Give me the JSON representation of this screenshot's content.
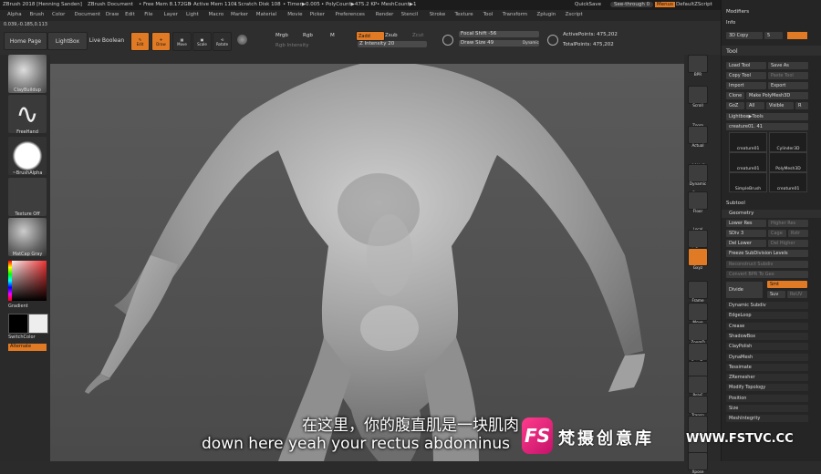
{
  "titlebar": {
    "app_title": "ZBrush 2018 [Henning Sanden]",
    "document": "ZBrush Document",
    "free_mem": "• Free Mem 8.172GB",
    "active_mem": "• Active Mem 1101",
    "scratch_disk": "• Scratch Disk 108",
    "timer": "• Timer▶0.005",
    "polycount": "• PolyCount▶475.2 KP",
    "meshcount": "• MeshCount▶1",
    "quicksave": "QuickSave",
    "see_through": "See-through  0",
    "menus": "Menus",
    "default_zscript": "DefaultZScript"
  },
  "menubar": [
    "Alpha",
    "Brush",
    "Color",
    "Document",
    "Draw",
    "Edit",
    "File",
    "Layer",
    "Light",
    "Macro",
    "Marker",
    "Material",
    "Movie",
    "Picker",
    "Preferences",
    "Render",
    "Stencil",
    "Stroke",
    "Texture",
    "Tool",
    "Transform",
    "Zplugin",
    "Zscript"
  ],
  "toolbar": {
    "coords": "0.039,-0.185,0.113",
    "home_page": "Home Page",
    "lightbox": "LightBox",
    "live_boolean": "Live Boolean",
    "edit": "Edit",
    "draw": "Draw",
    "move": "Move",
    "scale": "Scale",
    "rotate": "Rotate",
    "mrgb": "Mrgb",
    "rgb": "Rgb",
    "m": "M",
    "rgb_intensity": "Rgb Intensity",
    "zadd": "Zadd",
    "zsub": "Zsub",
    "zcut": "Zcut",
    "z_intensity": "Z Intensity 20",
    "focal_shift": "Focal Shift -56",
    "draw_size": "Draw Size 49",
    "dynamic": "Dynamic",
    "active_points": "ActivePoints: 475,202",
    "total_points": "TotalPoints: 475,202"
  },
  "leftshelf": {
    "brush": "ClayBuildup",
    "stroke": "FreeHand",
    "alpha": "~BrushAlpha",
    "texture": "Texture Off",
    "material": "MatCap Gray",
    "gradient": "Gradient",
    "switch_color": "SwitchColor",
    "alternate": "Alternate"
  },
  "rightshelf": [
    "BPR",
    "SPix 3",
    "Scroll",
    "Zoom",
    "Actual",
    "AAHalf",
    "Dynamic",
    "Persp",
    "Floor",
    "Local",
    "L.Sym",
    "Gxyz",
    "Frame",
    "Move",
    "ZoomD",
    "RotaTe",
    "Line Fill",
    "PolyF",
    "Transp",
    "Ghost",
    "Solo",
    "Xpose"
  ],
  "rpanel": {
    "modifiers": "Modifiers",
    "info": "Info",
    "copy_3d": "3D Copy",
    "copy_num": "5",
    "tool": "Tool",
    "load_tool": "Load Tool",
    "save_as": "Save As",
    "copy_tool": "Copy Tool",
    "paste_tool": "Paste Tool",
    "import": "Import",
    "export": "Export",
    "clone": "Clone",
    "make_polymesh": "Make PolyMesh3D",
    "goz": "GoZ",
    "all": "All",
    "visible": "Visible",
    "r": "R",
    "lightbox_tools": "Lightbox▶Tools",
    "tool_name": "creature01. 41",
    "thumbs": [
      "creature01",
      "Cylinder3D",
      "creature01",
      "PolyMesh3D",
      "SimpleBrush",
      "creature01"
    ],
    "subtool": "Subtool",
    "geometry": "Geometry",
    "lower_res": "Lower Res",
    "higher_res": "Higher Res",
    "sdiv": "SDiv 3",
    "cage": "Cage",
    "rstr": "Rstr",
    "del_lower": "Del Lower",
    "del_higher": "Del Higher",
    "freeze": "Freeze SubDivision Levels",
    "reconstruct": "Reconstruct Subdiv",
    "convert_bpr": "Convert BPR To Geo",
    "divide": "Divide",
    "smt": "Smt",
    "suv": "Suv",
    "reuv": "ReUV",
    "list": [
      "Dynamic Subdiv",
      "EdgeLoop",
      "Crease",
      "ShadowBox",
      "ClayPolish",
      "DynaMesh",
      "Tessimate",
      "ZRemesher",
      "Modify Topology",
      "Position",
      "Size",
      "MeshIntegrity"
    ]
  },
  "subtitle": {
    "chinese": "在这里，你的腹直肌是一块肌肉",
    "english": "down here yeah your rectus abdominus"
  },
  "watermark": {
    "logo": "FS",
    "name": "梵摄创意库",
    "url": "WWW.FSTVC.CC"
  },
  "colors": {
    "accent": "#e07a24",
    "panel": "#252525",
    "viewport": "#555555"
  }
}
